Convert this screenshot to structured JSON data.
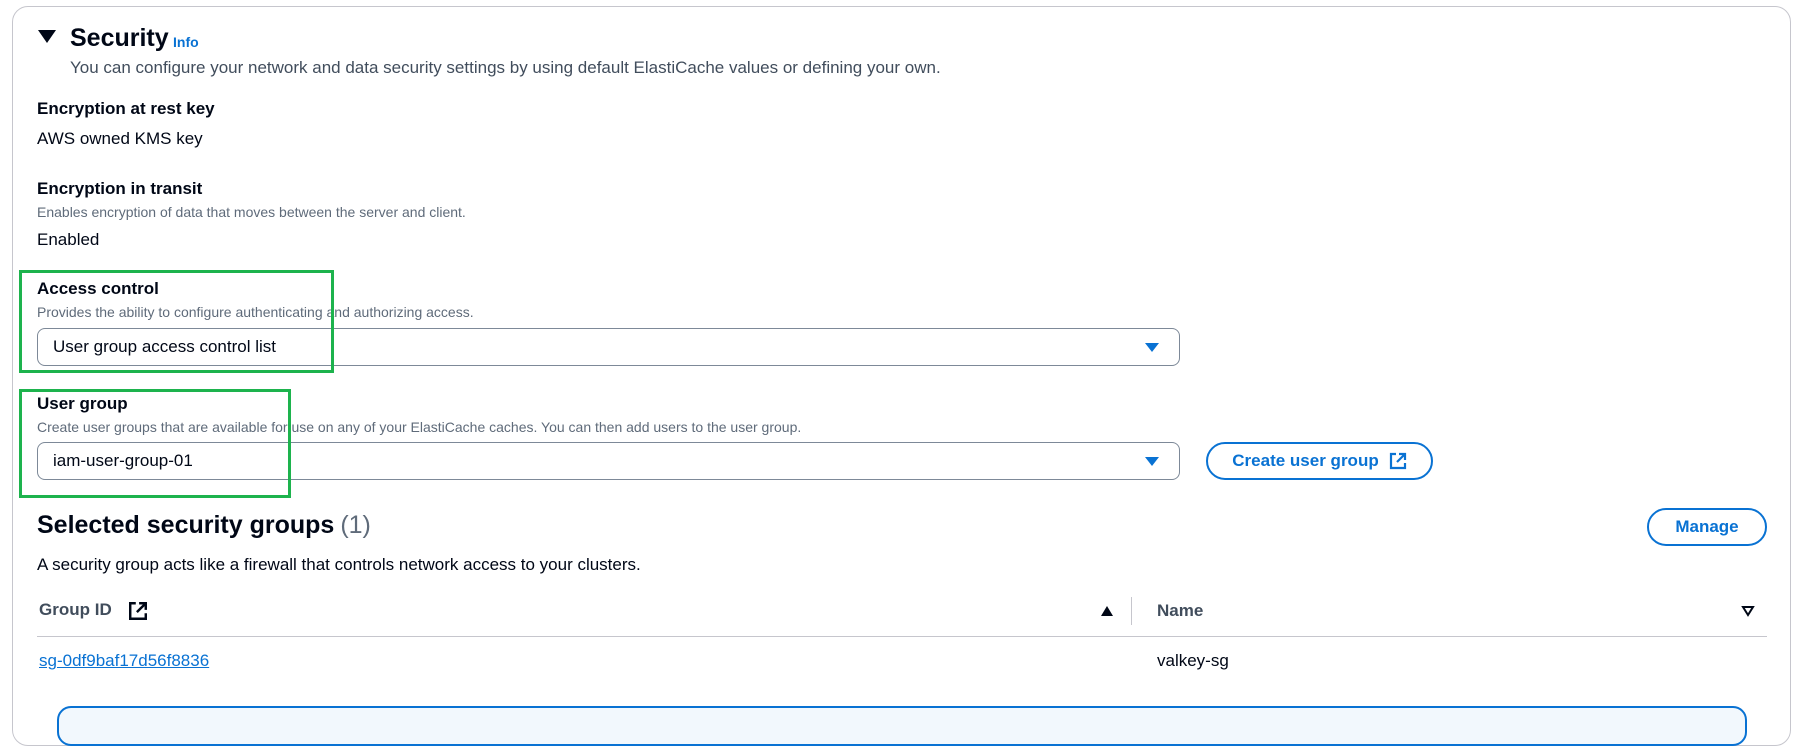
{
  "security": {
    "title": "Security",
    "info_label": "Info",
    "description": "You can configure your network and data security settings by using default ElastiCache values or defining your own."
  },
  "encryption_at_rest": {
    "label": "Encryption at rest key",
    "value": "AWS owned KMS key"
  },
  "encryption_in_transit": {
    "label": "Encryption in transit",
    "description": "Enables encryption of data that moves between the server and client.",
    "value": "Enabled"
  },
  "access_control": {
    "label": "Access control",
    "description": "Provides the ability to configure authenticating and authorizing access.",
    "selected": "User group access control list"
  },
  "user_group": {
    "label": "User group",
    "description": "Create user groups that are available for use on any of your ElastiCache caches. You can then add users to the user group.",
    "selected": "iam-user-group-01",
    "create_button": "Create user group"
  },
  "security_groups": {
    "title": "Selected security groups",
    "count": "(1)",
    "description": "A security group acts like a firewall that controls network access to your clusters.",
    "manage_button": "Manage",
    "columns": {
      "group_id": "Group ID",
      "name": "Name"
    },
    "rows": [
      {
        "group_id": "sg-0df9baf17d56f8836",
        "name": "valkey-sg"
      }
    ]
  },
  "colors": {
    "link": "#0972d3",
    "highlight": "#1db34d",
    "text": "#000716"
  }
}
